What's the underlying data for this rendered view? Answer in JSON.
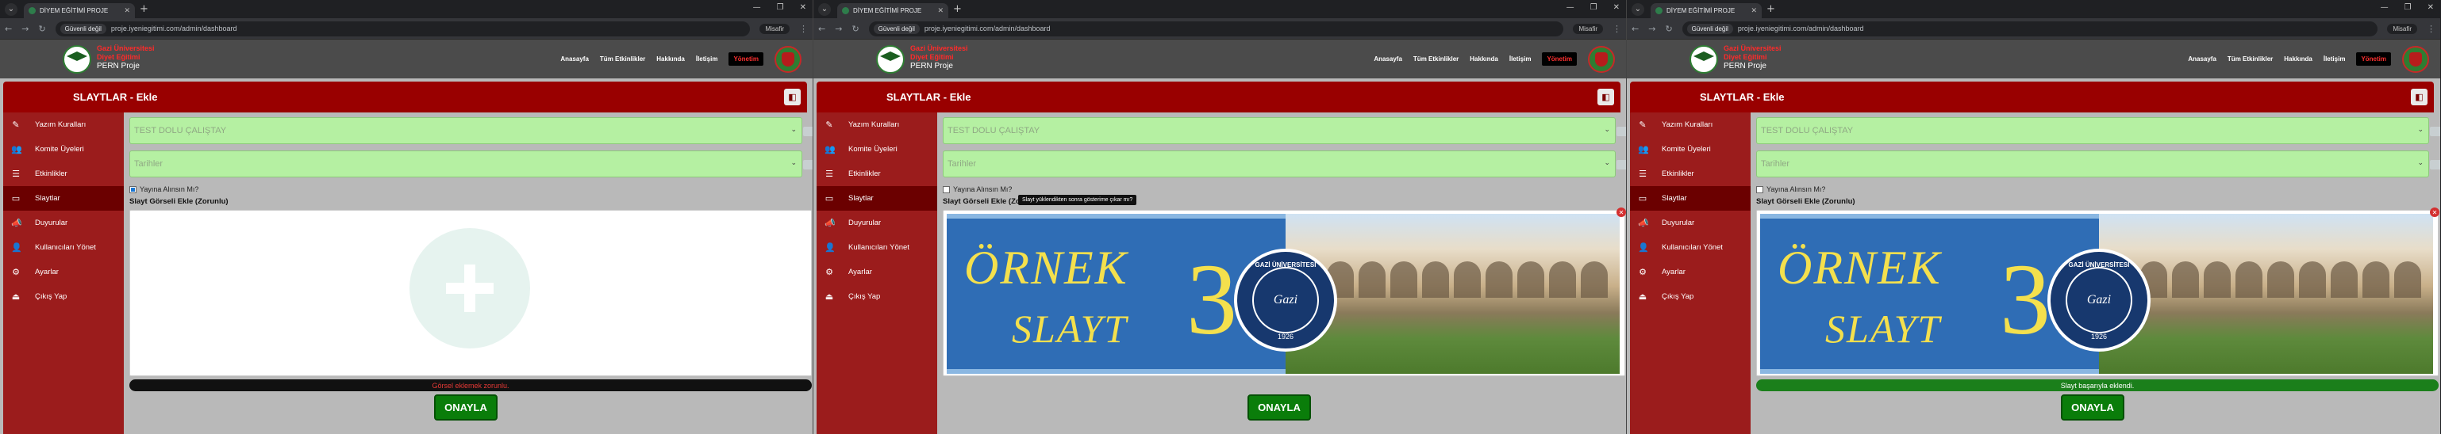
{
  "windows": [
    {
      "tab_title": "DİYEM EĞİTİMİ PROJE",
      "security_label": "Güvenli değil",
      "url": "proje.iyeniegitimi.com/admin/dashboard",
      "incognito_label": "Misafir",
      "site": {
        "line1": "Gazi Üniversitesi",
        "line2": "Diyet Eğitimi",
        "name": "PERN Proje"
      },
      "nav": [
        "Anasayfa",
        "Tüm Etkinlikler",
        "Hakkında",
        "İletişim",
        "Yönetim"
      ],
      "panel_title": "SLAYTLAR - Ekle",
      "sidebar": [
        {
          "icon": "✎",
          "label": "Yazım Kuralları"
        },
        {
          "icon": "👥",
          "label": "Komite Üyeleri"
        },
        {
          "icon": "☰",
          "label": "Etkinlikler"
        },
        {
          "icon": "▭",
          "label": "Slaytlar"
        },
        {
          "icon": "📣",
          "label": "Duyurular"
        },
        {
          "icon": "👤",
          "label": "Kullanıcıları Yönet"
        },
        {
          "icon": "⚙",
          "label": "Ayarlar"
        },
        {
          "icon": "⏏",
          "label": "Çıkış Yap"
        }
      ],
      "event_select": "TEST DOLU ÇALIŞTAY",
      "date_select": "Tarihler",
      "publish_label": "Yayına Alınsın Mı?",
      "publish_checked": true,
      "image_label": "Slayt Görseli Ekle (Zorunlu)",
      "tooltip": "",
      "has_slide": false,
      "status_text": "Görsel eklemek zorunlu.",
      "status_type": "error",
      "confirm_label": "ONAYLA"
    },
    {
      "tab_title": "DİYEM EĞİTİMİ PROJE",
      "security_label": "Güvenli değil",
      "url": "proje.iyeniegitimi.com/admin/dashboard",
      "incognito_label": "Misafir",
      "site": {
        "line1": "Gazi Üniversitesi",
        "line2": "Diyet Eğitimi",
        "name": "PERN Proje"
      },
      "nav": [
        "Anasayfa",
        "Tüm Etkinlikler",
        "Hakkında",
        "İletişim",
        "Yönetim"
      ],
      "panel_title": "SLAYTLAR - Ekle",
      "sidebar": [
        {
          "icon": "✎",
          "label": "Yazım Kuralları"
        },
        {
          "icon": "👥",
          "label": "Komite Üyeleri"
        },
        {
          "icon": "☰",
          "label": "Etkinlikler"
        },
        {
          "icon": "▭",
          "label": "Slaytlar"
        },
        {
          "icon": "📣",
          "label": "Duyurular"
        },
        {
          "icon": "👤",
          "label": "Kullanıcıları Yönet"
        },
        {
          "icon": "⚙",
          "label": "Ayarlar"
        },
        {
          "icon": "⏏",
          "label": "Çıkış Yap"
        }
      ],
      "event_select": "TEST DOLU ÇALIŞTAY",
      "date_select": "Tarihler",
      "publish_label": "Yayına Alınsın Mı?",
      "publish_checked": false,
      "image_label": "Slayt Görseli Ekle (Zorunlu)",
      "tooltip": "Slayt yüklendikten sonra gösterime çıkar mı?",
      "has_slide": true,
      "status_text": "",
      "status_type": "none",
      "confirm_label": "ONAYLA"
    },
    {
      "tab_title": "DİYEM EĞİTİMİ PROJE",
      "security_label": "Güvenli değil",
      "url": "proje.iyeniegitimi.com/admin/dashboard",
      "incognito_label": "Misafir",
      "site": {
        "line1": "Gazi Üniversitesi",
        "line2": "Diyet Eğitimi",
        "name": "PERN Proje"
      },
      "nav": [
        "Anasayfa",
        "Tüm Etkinlikler",
        "Hakkında",
        "İletişim",
        "Yönetim"
      ],
      "panel_title": "SLAYTLAR - Ekle",
      "sidebar": [
        {
          "icon": "✎",
          "label": "Yazım Kuralları"
        },
        {
          "icon": "👥",
          "label": "Komite Üyeleri"
        },
        {
          "icon": "☰",
          "label": "Etkinlikler"
        },
        {
          "icon": "▭",
          "label": "Slaytlar"
        },
        {
          "icon": "📣",
          "label": "Duyurular"
        },
        {
          "icon": "👤",
          "label": "Kullanıcıları Yönet"
        },
        {
          "icon": "⚙",
          "label": "Ayarlar"
        },
        {
          "icon": "⏏",
          "label": "Çıkış Yap"
        }
      ],
      "event_select": "TEST DOLU ÇALIŞTAY",
      "date_select": "Tarihler",
      "publish_label": "Yayına Alınsın Mı?",
      "publish_checked": false,
      "image_label": "Slayt Görseli Ekle (Zorunlu)",
      "tooltip": "",
      "has_slide": true,
      "status_text": "Slayt başarıyla eklendi.",
      "status_type": "success",
      "confirm_label": "ONAYLA"
    }
  ],
  "slide": {
    "line1": "ÖRNEK",
    "line2": "SLAYT",
    "number": "3",
    "seal_top": "GAZİ ÜNİVERSİTESİ",
    "seal_mid": "Gazi",
    "seal_year": "1926"
  },
  "colors": {
    "header_red": "#990000",
    "sidebar_red": "#9b1c1c",
    "select_green": "#b5f0a2",
    "confirm_green": "#0a7d0a",
    "success_green": "#1b7f1b",
    "error_red": "#e53935"
  },
  "selected_sidebar_index": 3,
  "selected_nav_index": 4
}
